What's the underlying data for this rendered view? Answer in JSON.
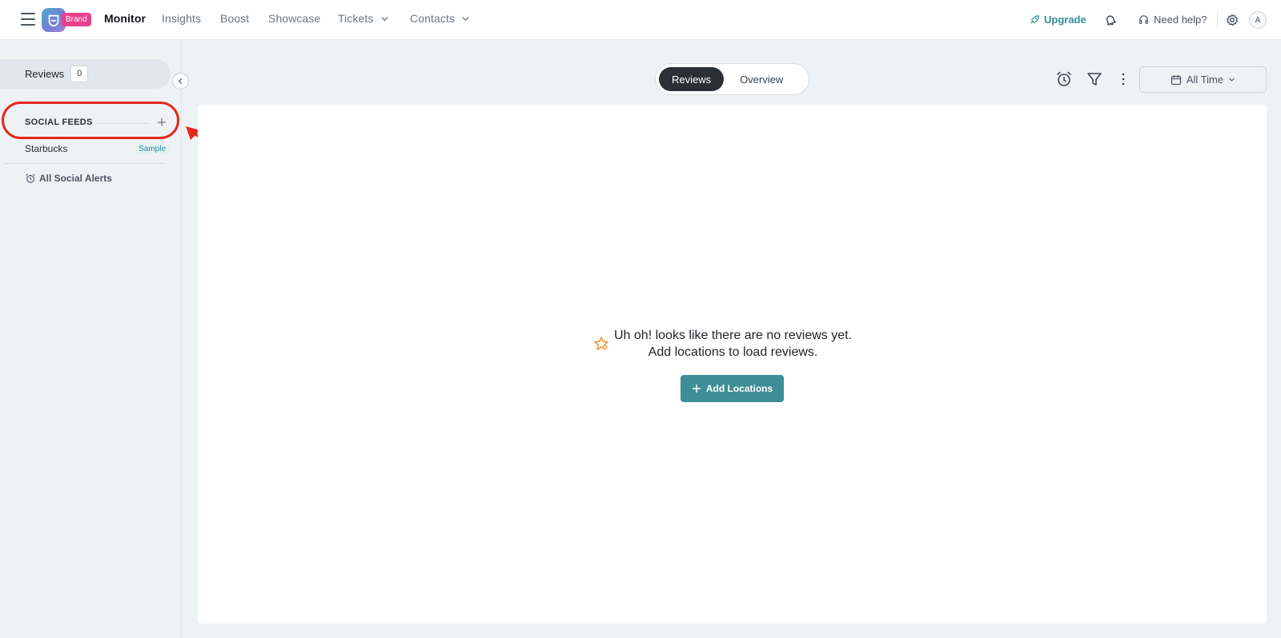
{
  "nav": {
    "brand_badge": "Brand",
    "items": [
      {
        "label": "Monitor"
      },
      {
        "label": "Insights"
      },
      {
        "label": "Boost"
      },
      {
        "label": "Showcase"
      },
      {
        "label": "Tickets"
      },
      {
        "label": "Contacts"
      }
    ],
    "active_item": "Monitor",
    "upgrade": "Upgrade",
    "help": "Need help?",
    "avatar": "A"
  },
  "sidebar": {
    "reviews_label": "Reviews",
    "reviews_count": "0",
    "social_feeds_title": "SOCIAL FEEDS",
    "feeds": [
      {
        "name": "Starbucks",
        "badge": "Sample"
      }
    ],
    "alerts_label": "All Social Alerts"
  },
  "toolbar": {
    "tabs": [
      {
        "label": "Reviews",
        "active": true
      },
      {
        "label": "Overview",
        "active": false
      }
    ],
    "date_range": "All Time"
  },
  "main": {
    "empty_line1": "Uh oh! looks like there are no reviews yet.",
    "empty_line2": "Add locations to load reviews.",
    "add_button": "Add Locations"
  },
  "colors": {
    "accent_teal": "#3f8e97",
    "brand_pink": "#e8418b",
    "annotation_red": "#e8271c",
    "empty_icon_orange": "#f08a24"
  },
  "icons": [
    "hamburger-icon",
    "logo-icon",
    "chevron-down-icon",
    "rocket-icon",
    "bell-icon",
    "headset-icon",
    "gear-icon",
    "chevron-left-icon",
    "plus-icon",
    "alarm-icon",
    "filter-icon",
    "kebab-icon",
    "calendar-icon",
    "star-icon"
  ]
}
